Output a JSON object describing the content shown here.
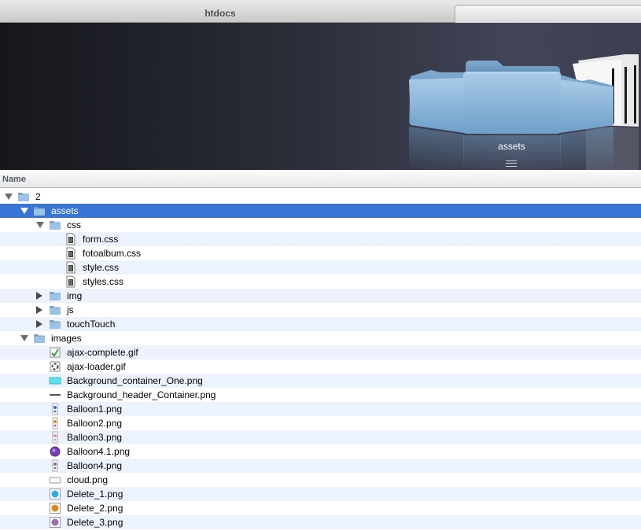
{
  "window": {
    "title": "htdocs"
  },
  "coverflow": {
    "current_label": "assets"
  },
  "columns": {
    "name": "Name"
  },
  "rows": [
    {
      "label": "2",
      "level": 0,
      "type": "folder",
      "disclosure": "open",
      "name": "folder-row-2"
    },
    {
      "label": "assets",
      "level": 1,
      "type": "folder",
      "disclosure": "open",
      "selected": true,
      "name": "folder-row-assets"
    },
    {
      "label": "css",
      "level": 2,
      "type": "folder",
      "disclosure": "open",
      "name": "folder-row-css"
    },
    {
      "label": "form.css",
      "level": 3,
      "type": "css",
      "name": "file-row-form-css"
    },
    {
      "label": "fotoalbum.css",
      "level": 3,
      "type": "css",
      "name": "file-row-fotoalbum-css"
    },
    {
      "label": "style.css",
      "level": 3,
      "type": "css",
      "name": "file-row-style-css"
    },
    {
      "label": "styles.css",
      "level": 3,
      "type": "css",
      "name": "file-row-styles-css"
    },
    {
      "label": "img",
      "level": 2,
      "type": "folder",
      "disclosure": "closed",
      "name": "folder-row-img"
    },
    {
      "label": "js",
      "level": 2,
      "type": "folder",
      "disclosure": "closed",
      "name": "folder-row-js"
    },
    {
      "label": "touchTouch",
      "level": 2,
      "type": "folder",
      "disclosure": "closed",
      "name": "folder-row-touchtouch"
    },
    {
      "label": "images",
      "level": 1,
      "type": "folder",
      "disclosure": "open",
      "name": "folder-row-images"
    },
    {
      "label": "ajax-complete.gif",
      "level": 2,
      "type": "img-check",
      "name": "file-row-ajax-complete"
    },
    {
      "label": "ajax-loader.gif",
      "level": 2,
      "type": "img-loader",
      "name": "file-row-ajax-loader"
    },
    {
      "label": "Background_container_One.png",
      "level": 2,
      "type": "img-cyanbar",
      "name": "file-row-background-container"
    },
    {
      "label": "Background_header_Container.png",
      "level": 2,
      "type": "img-line",
      "name": "file-row-background-header"
    },
    {
      "label": "Balloon1.png",
      "level": 2,
      "type": "img-balloon-blue",
      "name": "file-row-balloon1"
    },
    {
      "label": "Balloon2.png",
      "level": 2,
      "type": "img-balloon-orange",
      "name": "file-row-balloon2"
    },
    {
      "label": "Balloon3.png",
      "level": 2,
      "type": "img-balloon-pink",
      "name": "file-row-balloon3"
    },
    {
      "label": "Balloon4.1.png",
      "level": 2,
      "type": "img-balloon-purple",
      "name": "file-row-balloon4-1"
    },
    {
      "label": "Balloon4.png",
      "level": 2,
      "type": "img-balloon-grey",
      "name": "file-row-balloon4"
    },
    {
      "label": "cloud.png",
      "level": 2,
      "type": "img-cloud",
      "name": "file-row-cloud"
    },
    {
      "label": "Delete_1.png",
      "level": 2,
      "type": "img-delete-blue",
      "name": "file-row-delete1"
    },
    {
      "label": "Delete_2.png",
      "level": 2,
      "type": "img-delete-orange",
      "name": "file-row-delete2"
    },
    {
      "label": "Delete_3.png",
      "level": 2,
      "type": "img-delete-purple",
      "name": "file-row-delete3"
    }
  ],
  "icons": {
    "folder": "folder-icon",
    "css": "css-file-icon",
    "img-check": "image-file-icon",
    "img-loader": "loader-image-icon",
    "img-cyanbar": "image-file-icon",
    "img-line": "image-file-icon",
    "img-balloon-blue": "balloon-image-icon",
    "img-balloon-orange": "balloon-image-icon",
    "img-balloon-pink": "balloon-image-icon",
    "img-balloon-purple": "balloon-image-icon",
    "img-balloon-grey": "balloon-image-icon",
    "img-cloud": "cloud-image-icon",
    "img-delete-blue": "delete-image-icon",
    "img-delete-orange": "delete-image-icon",
    "img-delete-purple": "delete-image-icon"
  },
  "colors": {
    "selection": "#3875d7",
    "stripe": "#edf3fe",
    "folder": "#8fb8dc"
  }
}
